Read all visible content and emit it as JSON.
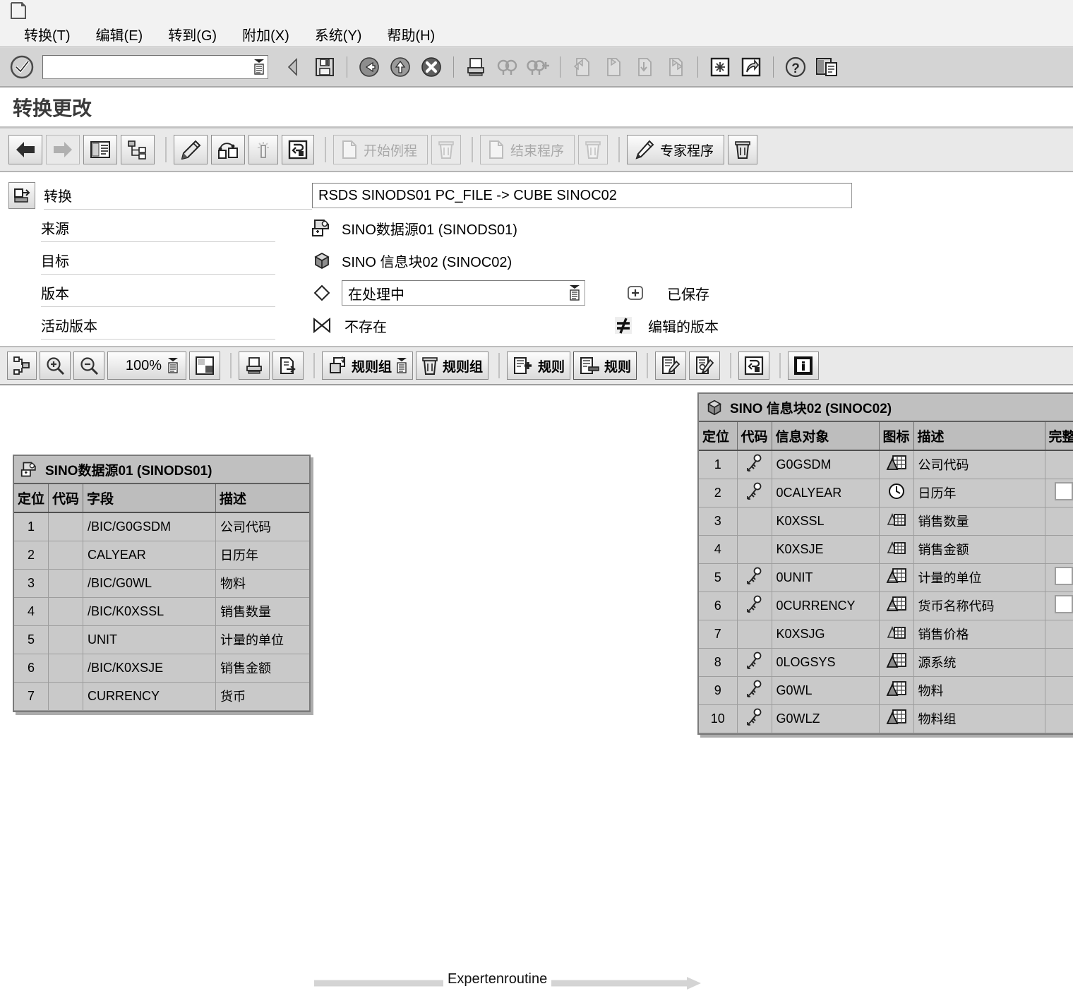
{
  "window": {
    "icon": "window-document-icon"
  },
  "menubar": {
    "items": [
      {
        "label": "转换(T)",
        "name": "menu-transformation"
      },
      {
        "label": "编辑(E)",
        "name": "menu-edit"
      },
      {
        "label": "转到(G)",
        "name": "menu-goto"
      },
      {
        "label": "附加(X)",
        "name": "menu-extras"
      },
      {
        "label": "系统(Y)",
        "name": "menu-system"
      },
      {
        "label": "帮助(H)",
        "name": "menu-help"
      }
    ]
  },
  "systoolbar": {
    "command_value": "",
    "command_placeholder": "",
    "buttons": [
      {
        "icon": "back-triangle-icon",
        "enabled": true
      },
      {
        "icon": "save-icon",
        "enabled": true
      },
      {
        "icon": "back-green-icon",
        "enabled": true
      },
      {
        "icon": "exit-up-icon",
        "enabled": true
      },
      {
        "icon": "cancel-x-icon",
        "enabled": true
      },
      {
        "icon": "print-icon",
        "enabled": true
      },
      {
        "icon": "find-icon",
        "enabled": true
      },
      {
        "icon": "find-next-icon",
        "enabled": true
      },
      {
        "icon": "first-page-icon",
        "enabled": false
      },
      {
        "icon": "previous-page-icon",
        "enabled": false
      },
      {
        "icon": "next-page-icon",
        "enabled": false
      },
      {
        "icon": "last-page-icon",
        "enabled": false
      },
      {
        "icon": "create-session-icon",
        "enabled": true
      },
      {
        "icon": "create-shortcut-icon",
        "enabled": true
      },
      {
        "icon": "help-icon",
        "enabled": true
      },
      {
        "icon": "layout-menu-icon",
        "enabled": true
      }
    ]
  },
  "screen": {
    "title": "转换更改"
  },
  "apptoolbar": {
    "buttons": [
      {
        "name": "back-button",
        "icon": "arrow-left-icon",
        "label": "",
        "enabled": true
      },
      {
        "name": "forward-button",
        "icon": "arrow-right-icon",
        "label": "",
        "enabled": false
      },
      {
        "name": "detail-view-button",
        "icon": "detail-list-icon",
        "label": "",
        "enabled": true
      },
      {
        "name": "hierarchy-button",
        "icon": "hierarchy-icon",
        "label": "",
        "enabled": true
      },
      {
        "name": "rule-edit-button",
        "icon": "pencil-rule-icon",
        "label": "",
        "enabled": true
      },
      {
        "name": "graphic-button",
        "icon": "network-graphic-icon",
        "label": "",
        "enabled": true
      },
      {
        "name": "check-button",
        "icon": "wand-icon",
        "label": "",
        "enabled": true
      },
      {
        "name": "generate-button",
        "icon": "generate-icon",
        "label": "",
        "enabled": true
      },
      {
        "name": "start-routine-button",
        "icon": "page-icon",
        "label": "开始例程",
        "enabled": false
      },
      {
        "name": "delete-start-routine-button",
        "icon": "trash-icon",
        "label": "",
        "enabled": false
      },
      {
        "name": "end-routine-button",
        "icon": "page-icon",
        "label": "结束程序",
        "enabled": false
      },
      {
        "name": "delete-end-routine-button",
        "icon": "trash-icon",
        "label": "",
        "enabled": false
      },
      {
        "name": "expert-routine-button",
        "icon": "pencil-icon",
        "label": "专家程序",
        "enabled": true
      },
      {
        "name": "delete-expert-routine-button",
        "icon": "trash-icon",
        "label": "",
        "enabled": true
      }
    ]
  },
  "attributes": {
    "transformation": {
      "label": "转换",
      "value": "RSDS SINODS01 PC_FILE -> CUBE SINOC02",
      "icon": "transformation-icon"
    },
    "source": {
      "label": "来源",
      "value": "SINO数据源01 (SINODS01)",
      "icon": "datasource-icon"
    },
    "target": {
      "label": "目标",
      "value": "SINO 信息块02 (SINOC02)",
      "icon": "infocube-icon"
    },
    "version": {
      "label": "版本",
      "value": "在处理中",
      "icon": "diamond-icon",
      "status_icon": "plus-box-icon",
      "status_label": "已保存"
    },
    "active_version": {
      "label": "活动版本",
      "value": "不存在",
      "icon": "not-equal-bowtie-icon",
      "status_icon": "not-equal-icon",
      "status_label": "编辑的版本"
    }
  },
  "toolbar2": {
    "zoom_level": "100%",
    "buttons": [
      {
        "name": "layout-button",
        "icon": "layout-node-icon",
        "label": ""
      },
      {
        "name": "zoom-in-button",
        "icon": "zoom-in-icon",
        "label": ""
      },
      {
        "name": "zoom-out-button",
        "icon": "zoom-out-icon",
        "label": ""
      },
      {
        "name": "fit-view-button",
        "icon": "fit-window-icon",
        "label": ""
      },
      {
        "name": "print-graphic-button",
        "icon": "print-icon",
        "label": ""
      },
      {
        "name": "export-graphic-button",
        "icon": "export-icon",
        "label": ""
      },
      {
        "name": "create-rule-group-button",
        "icon": "rule-group-add-icon",
        "label": "规则组"
      },
      {
        "name": "delete-rule-group-button",
        "icon": "trash-icon",
        "label": "规则组"
      },
      {
        "name": "create-rule-button",
        "icon": "rule-add-icon",
        "label": "规则"
      },
      {
        "name": "delete-rule-button",
        "icon": "rule-remove-icon",
        "label": "规则"
      },
      {
        "name": "edit-rule-button",
        "icon": "edit-note-icon",
        "label": ""
      },
      {
        "name": "edit-rule-detail-button",
        "icon": "edit-note-alt-icon",
        "label": ""
      },
      {
        "name": "refresh-button",
        "icon": "generate-icon",
        "label": ""
      },
      {
        "name": "info-button",
        "icon": "info-icon",
        "label": ""
      }
    ]
  },
  "canvas": {
    "connector_label": "Expertenroutine",
    "source_table": {
      "caption": "SINO数据源01 (SINODS01)",
      "caption_icon": "datasource-icon",
      "columns": [
        "定位",
        "代码",
        "字段",
        "描述"
      ],
      "rows": [
        {
          "pos": "1",
          "code": "",
          "field": "/BIC/G0GSDM",
          "desc": "公司代码"
        },
        {
          "pos": "2",
          "code": "",
          "field": "CALYEAR",
          "desc": "日历年"
        },
        {
          "pos": "3",
          "code": "",
          "field": "/BIC/G0WL",
          "desc": "物料"
        },
        {
          "pos": "4",
          "code": "",
          "field": "/BIC/K0XSSL",
          "desc": "销售数量"
        },
        {
          "pos": "5",
          "code": "",
          "field": "UNIT",
          "desc": "计量的单位"
        },
        {
          "pos": "6",
          "code": "",
          "field": "/BIC/K0XSJE",
          "desc": "销售金额"
        },
        {
          "pos": "7",
          "code": "",
          "field": "CURRENCY",
          "desc": "货币"
        }
      ]
    },
    "target_table": {
      "caption": "SINO 信息块02 (SINOC02)",
      "caption_icon": "infocube-icon",
      "columns": [
        "定位",
        "代码",
        "信息对象",
        "图标",
        "描述",
        "完整"
      ],
      "rows": [
        {
          "pos": "1",
          "key": "key-icon",
          "iobj": "G0GSDM",
          "type": "characteristic-icon",
          "desc": "公司代码",
          "complete": false
        },
        {
          "pos": "2",
          "key": "key-icon",
          "iobj": "0CALYEAR",
          "type": "time-clock-icon",
          "desc": "日历年",
          "complete": true
        },
        {
          "pos": "3",
          "key": "",
          "iobj": "K0XSSL",
          "type": "keyfigure-icon",
          "desc": "销售数量",
          "complete": false
        },
        {
          "pos": "4",
          "key": "",
          "iobj": "K0XSJE",
          "type": "keyfigure-icon",
          "desc": "销售金额",
          "complete": false
        },
        {
          "pos": "5",
          "key": "key-icon",
          "iobj": "0UNIT",
          "type": "unit-icon",
          "desc": "计量的单位",
          "complete": true
        },
        {
          "pos": "6",
          "key": "key-icon",
          "iobj": "0CURRENCY",
          "type": "unit-icon",
          "desc": "货币名称代码",
          "complete": true
        },
        {
          "pos": "7",
          "key": "",
          "iobj": "K0XSJG",
          "type": "keyfigure-icon",
          "desc": "销售价格",
          "complete": false
        },
        {
          "pos": "8",
          "key": "key-icon",
          "iobj": "0LOGSYS",
          "type": "characteristic-icon",
          "desc": "源系统",
          "complete": false
        },
        {
          "pos": "9",
          "key": "key-icon",
          "iobj": "G0WL",
          "type": "characteristic-icon",
          "desc": "物料",
          "complete": false
        },
        {
          "pos": "10",
          "key": "key-icon",
          "iobj": "G0WLZ",
          "type": "characteristic-icon",
          "desc": "物料组",
          "complete": false
        }
      ]
    }
  },
  "colors": {
    "toolbar_bg": "#d4d4d4",
    "table_bg": "#c9c9c9",
    "header_bg": "#bdbdbd",
    "title_text": "#3a3a3a",
    "connector": "#d0d0d0"
  }
}
